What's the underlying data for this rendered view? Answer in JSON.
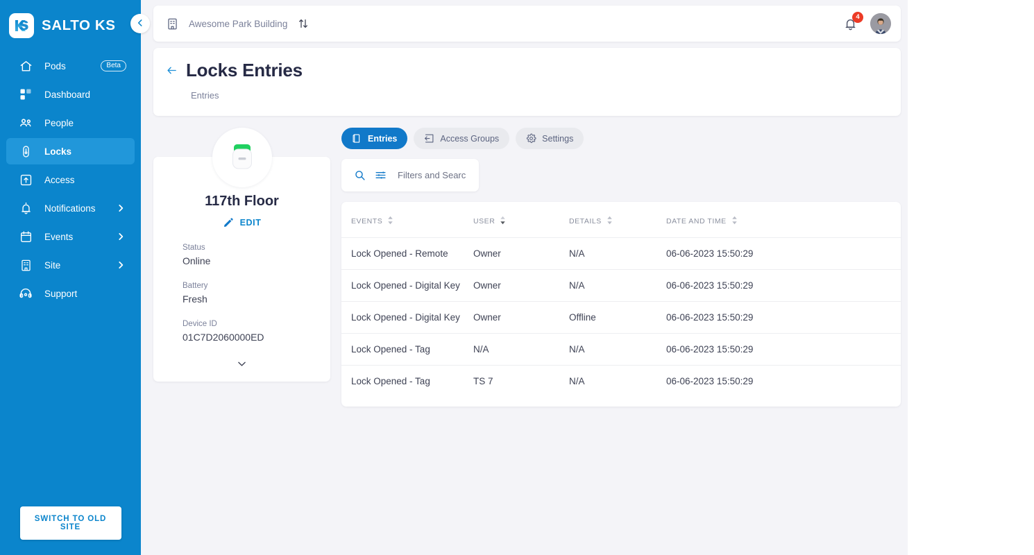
{
  "brand": {
    "name": "SALTO KS",
    "logo_text": "KS",
    "collapse_icon": "chevron-left-icon"
  },
  "sidebar": {
    "items": [
      {
        "label": "Pods",
        "icon": "home-icon",
        "badge": "Beta",
        "active": false,
        "chevron": false
      },
      {
        "label": "Dashboard",
        "icon": "grid-icon",
        "badge": null,
        "active": false,
        "chevron": false
      },
      {
        "label": "People",
        "icon": "people-icon",
        "badge": null,
        "active": false,
        "chevron": false
      },
      {
        "label": "Locks",
        "icon": "lock-icon",
        "badge": null,
        "active": true,
        "chevron": false
      },
      {
        "label": "Access",
        "icon": "access-login-icon",
        "badge": null,
        "active": false,
        "chevron": false
      },
      {
        "label": "Notifications",
        "icon": "bell-icon",
        "badge": null,
        "active": false,
        "chevron": true
      },
      {
        "label": "Events",
        "icon": "calendar-icon",
        "badge": null,
        "active": false,
        "chevron": true
      },
      {
        "label": "Site",
        "icon": "building-icon",
        "badge": null,
        "active": false,
        "chevron": true
      },
      {
        "label": "Support",
        "icon": "headset-icon",
        "badge": null,
        "active": false,
        "chevron": false
      }
    ],
    "switch_site_label": "SWITCH TO OLD SITE"
  },
  "topbar": {
    "site_icon": "building-icon",
    "site_name": "Awesome Park Building",
    "swap_icon": "swap-vertical-icon",
    "bell_icon": "bell-icon",
    "notification_count": "4",
    "avatar": "user-avatar"
  },
  "page": {
    "back_icon": "arrow-left-icon",
    "title": "Locks Entries",
    "subtitle": "Entries"
  },
  "device": {
    "image": "salto-lock-device",
    "name": "117th Floor",
    "edit_icon": "pencil-icon",
    "edit_label": "EDIT",
    "expand_icon": "chevron-down-icon",
    "fields": [
      {
        "label": "Status",
        "value": "Online"
      },
      {
        "label": "Battery",
        "value": "Fresh"
      },
      {
        "label": "Device ID",
        "value": "01C7D2060000ED"
      }
    ]
  },
  "tabs": [
    {
      "label": "Entries",
      "icon": "door-icon",
      "active": true
    },
    {
      "label": "Access Groups",
      "icon": "access-login-icon",
      "active": false
    },
    {
      "label": "Settings",
      "icon": "gear-icon",
      "active": false
    }
  ],
  "search": {
    "search_icon": "search-icon",
    "filter_icon": "filter-sliders-icon",
    "placeholder": "Filters and Search",
    "value": ""
  },
  "table": {
    "columns": [
      {
        "key": "events",
        "label": "EVENTS",
        "sort": "none"
      },
      {
        "key": "user",
        "label": "USER",
        "sort": "desc"
      },
      {
        "key": "details",
        "label": "DETAILS",
        "sort": "none"
      },
      {
        "key": "date",
        "label": "DATE AND TIME",
        "sort": "none"
      }
    ],
    "rows": [
      {
        "events": "Lock Opened - Remote",
        "user": "Owner",
        "details": "N/A",
        "date": "06-06-2023 15:50:29"
      },
      {
        "events": "Lock Opened - Digital Key",
        "user": "Owner",
        "details": "N/A",
        "date": "06-06-2023 15:50:29"
      },
      {
        "events": "Lock Opened - Digital Key",
        "user": "Owner",
        "details": "Offline",
        "date": "06-06-2023 15:50:29"
      },
      {
        "events": "Lock Opened - Tag",
        "user": "N/A",
        "details": "N/A",
        "date": "06-06-2023 15:50:29"
      },
      {
        "events": "Lock Opened - Tag",
        "user": "TS 7",
        "details": "N/A",
        "date": "06-06-2023 15:50:29"
      }
    ]
  },
  "colors": {
    "sidebar_blue": "#0b85cc",
    "sidebar_active": "#2197da",
    "accent_blue": "#1179c9",
    "badge_red": "#ec3b26",
    "device_green": "#20d060",
    "page_bg": "#f4f4f8",
    "text_dark": "#262a45",
    "text_muted": "#7b819a"
  }
}
